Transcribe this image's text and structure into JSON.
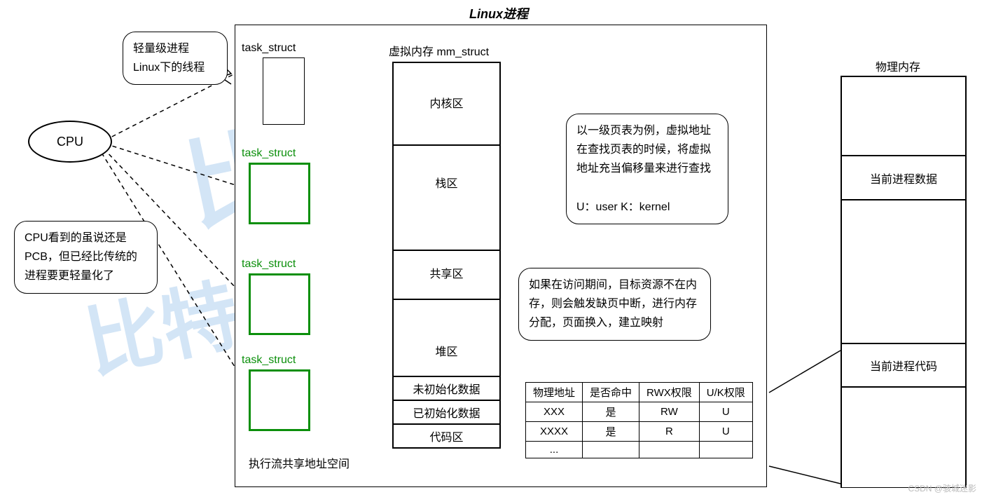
{
  "title": "Linux进程",
  "cpu": {
    "label": "CPU"
  },
  "bubble_lwp": "轻量级进程\nLinux下的线程",
  "bubble_pcb": "CPU看到的虽说还是PCB，但已经比传统的进程要更轻量化了",
  "task_struct_main": "task_struct",
  "task_struct_g1": "task_struct",
  "task_struct_g2": "task_struct",
  "task_struct_g3": "task_struct",
  "mm_struct_title": "虚拟内存 mm_struct",
  "mm": {
    "kernel": "内核区",
    "stack": "栈区",
    "shared": "共享区",
    "heap": "堆区",
    "bss": "未初始化数据",
    "data": "已初始化数据",
    "code": "代码区"
  },
  "exec_share": "执行流共享地址空间",
  "bubble_vpt": "以一级页表为例，虚拟地址在查找页表的时候，将虚拟地址充当偏移量来进行查找\n\nU：user  K：kernel",
  "bubble_fault": "如果在访问期间，目标资源不在内存，则会触发缺页中断，进行内存分配，页面换入，建立映射",
  "ptable": {
    "headers": [
      "物理地址",
      "是否命中",
      "RWX权限",
      "U/K权限"
    ],
    "rows": [
      [
        "XXX",
        "是",
        "RW",
        "U"
      ],
      [
        "XXXX",
        "是",
        "R",
        "U"
      ],
      [
        "...",
        "",
        "",
        ""
      ]
    ]
  },
  "phys": {
    "title": "物理内存",
    "data": "当前进程数据",
    "code": "当前进程代码"
  },
  "attr": "CSDN @骇城迷影"
}
